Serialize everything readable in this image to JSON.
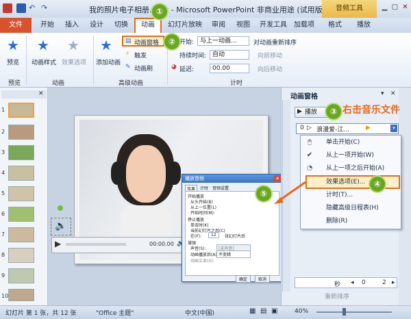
{
  "title": {
    "text": "我的照片电子相册.pptx - Microsoft PowerPoint 非商业用途 (试用版)",
    "context_tool": "音频工具"
  },
  "tabs": [
    "文件",
    "开始",
    "插入",
    "设计",
    "切换",
    "动画",
    "幻灯片放映",
    "审阅",
    "视图",
    "开发工具",
    "加载项",
    "格式",
    "播放"
  ],
  "ribbon": {
    "preview": "预览",
    "anim_style": "动画样式",
    "effect_options": "效果选项",
    "add_anim": "添加动画",
    "anim_pane": "动画窗格",
    "trigger": "触发",
    "painter": "动画刷",
    "start_label": "开始:",
    "start_value": "与上一动画...",
    "duration_label": "持续时间:",
    "duration_value": "自动",
    "delay_label": "延迟:",
    "delay_value": "00.00",
    "reorder_title": "对动画重新排序",
    "move_earlier": "向前移动",
    "move_later": "向后移动",
    "groups": [
      "预览",
      "动画",
      "高级动画",
      "计时"
    ]
  },
  "slides": {
    "numbers": [
      "1",
      "2",
      "3",
      "4",
      "5",
      "6",
      "7",
      "8",
      "9",
      "10",
      "11"
    ]
  },
  "player": {
    "time": "00:00.00"
  },
  "dialog": {
    "title": "播放音频",
    "tabs": [
      "效果",
      "计时",
      "音频设置"
    ],
    "sec_start": "开始播放",
    "opt_start1": "从头开始(B)",
    "opt_start2": "从上一位置(L)",
    "opt_start3": "开始时间(M):",
    "sec_stop": "停止播放",
    "opt_stop1": "单击时(K)",
    "opt_stop2": "当前幻灯片之后(C)",
    "opt_stop3": "在(F):",
    "stop_count": "12",
    "stop_unit": "张幻灯片后",
    "sec_enh": "增强",
    "enh_sound": "声音(S):",
    "enh_sound_val": "[无声音]",
    "enh_after": "动画播放后(A):",
    "enh_after_val": "不变暗",
    "enh_text": "动画文本(X):",
    "ok": "确定",
    "cancel": "取消"
  },
  "pane": {
    "title": "动画窗格",
    "play": "播放",
    "item_num": "0",
    "item_label": "浪漫爱-江...",
    "menu": [
      "单击开始(C)",
      "从上一项开始(W)",
      "从上一项之后开始(A)",
      "效果选项(E)...",
      "计时(T)...",
      "隐藏高级日程表(H)",
      "删除(R)"
    ],
    "seconds": "秒",
    "page_a": "0",
    "page_b": "2",
    "reorder": "重新排序"
  },
  "annotation": {
    "right_click": "右击音乐文件",
    "steps": [
      "①",
      "②",
      "③",
      "④",
      "⑤"
    ]
  },
  "status": {
    "slide": "幻灯片 第 1 张，共 12 张",
    "theme": "\"Office 主题\"",
    "lang": "中文(中国)",
    "zoom": "40%"
  },
  "colors": {
    "accent_orange": "#e8681a",
    "callout_green": "#6aa620",
    "file_tab": "#d9522c"
  }
}
